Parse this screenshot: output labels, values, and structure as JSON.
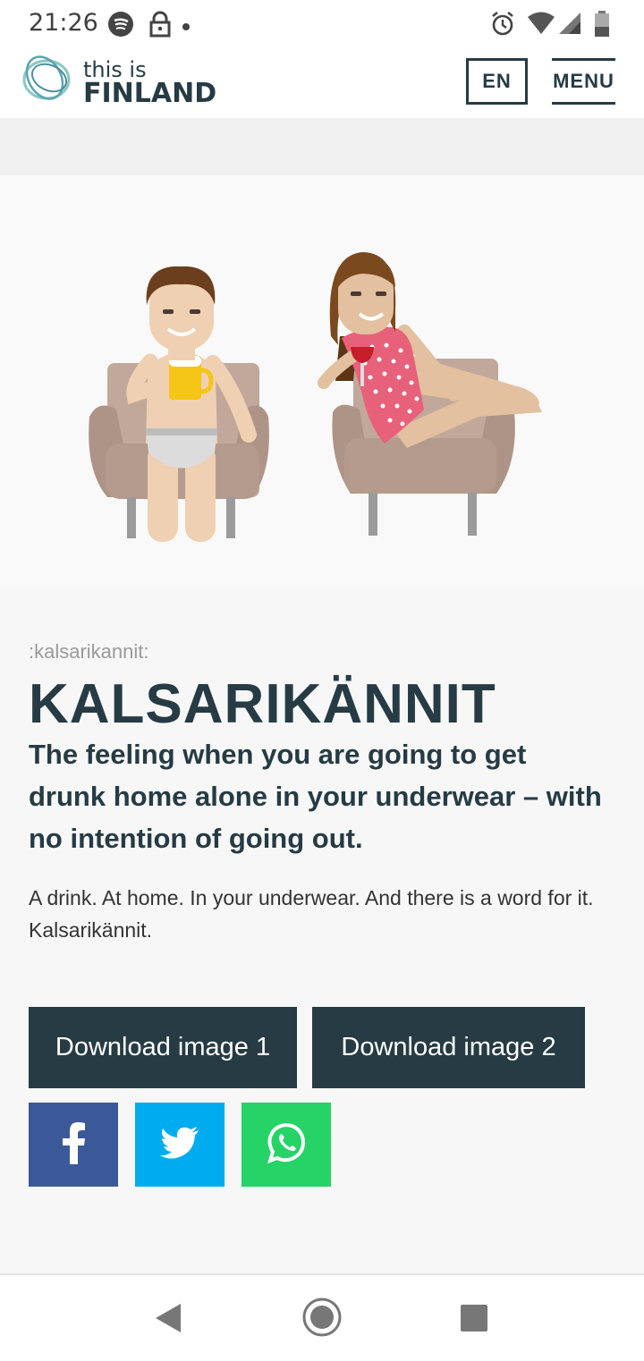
{
  "status_bar": {
    "time": "21:26",
    "icons": [
      "spotify-icon",
      "lock-icon",
      "dot-icon",
      "alarm-icon",
      "wifi-icon",
      "signal-icon",
      "battery-icon"
    ]
  },
  "header": {
    "logo_small": "this is",
    "logo_big": "FINLAND",
    "language_label": "EN",
    "menu_label": "MENU"
  },
  "article": {
    "slug": ":kalsarikannit:",
    "title": "KALSARIKÄNNIT",
    "subtitle": "The feeling when you are going to get drunk home alone in your underwear – with no intention of going out.",
    "body": "A drink. At home. In your underwear. And there is a word for it. Kalsarikännit."
  },
  "actions": {
    "download_1": "Download image 1",
    "download_2": "Download image 2"
  },
  "share": {
    "facebook_color": "#3b5998",
    "twitter_color": "#00acee",
    "whatsapp_color": "#25d366"
  },
  "colors": {
    "accent": "#263b44"
  }
}
